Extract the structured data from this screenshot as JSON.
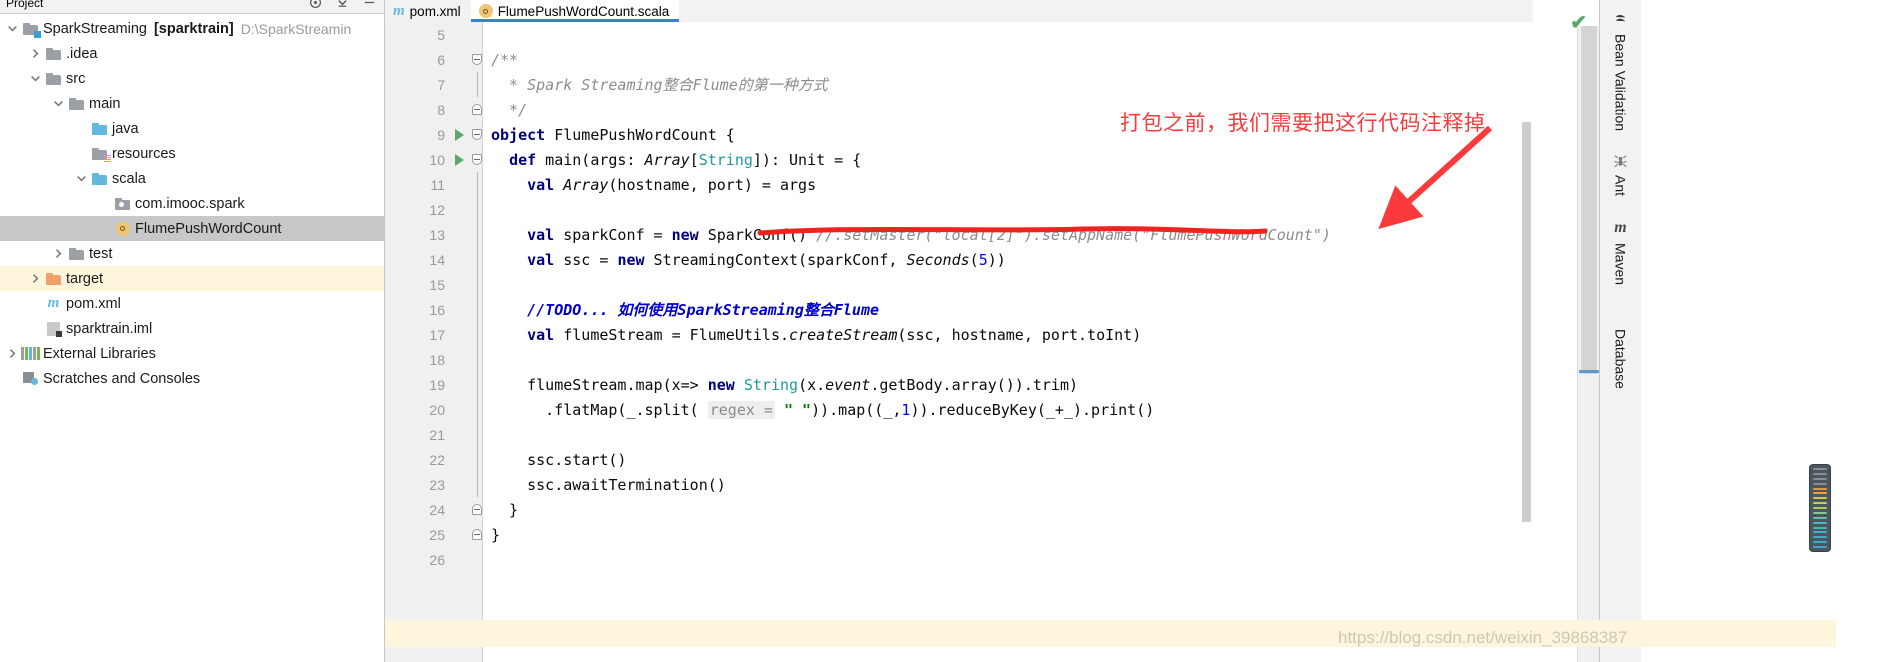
{
  "window": {
    "ide": "IntelliJ IDEA",
    "watermark": "https://blog.csdn.net/weixin_39868387"
  },
  "project_panel": {
    "title": "Project",
    "toolbar_icons": [
      "target-icon",
      "collapse-icon",
      "settings-icon"
    ],
    "tree": [
      {
        "label": "SparkStreaming",
        "bracket": "[sparktrain]",
        "path": "D:\\SparkStreamin",
        "icon": "module-folder-icon",
        "indent": 0,
        "arrow": "expanded",
        "state": "normal"
      },
      {
        "label": ".idea",
        "icon": "folder-gray-icon",
        "indent": 1,
        "arrow": "collapsed",
        "state": "normal"
      },
      {
        "label": "src",
        "icon": "folder-gray-icon",
        "indent": 1,
        "arrow": "expanded",
        "state": "normal"
      },
      {
        "label": "main",
        "icon": "folder-gray-icon",
        "indent": 2,
        "arrow": "expanded",
        "state": "normal"
      },
      {
        "label": "java",
        "icon": "folder-source-blue-icon",
        "indent": 3,
        "arrow": "none",
        "state": "normal"
      },
      {
        "label": "resources",
        "icon": "folder-resources-icon",
        "indent": 3,
        "arrow": "none",
        "state": "normal"
      },
      {
        "label": "scala",
        "icon": "folder-source-blue-icon",
        "indent": 3,
        "arrow": "expanded",
        "state": "normal"
      },
      {
        "label": "com.imooc.spark",
        "icon": "package-icon",
        "indent": 4,
        "arrow": "none",
        "state": "normal"
      },
      {
        "label": "FlumePushWordCount",
        "icon": "scala-object-icon",
        "indent": 4,
        "arrow": "none",
        "state": "selected"
      },
      {
        "label": "test",
        "icon": "folder-gray-icon",
        "indent": 2,
        "arrow": "collapsed",
        "state": "normal"
      },
      {
        "label": "target",
        "icon": "folder-orange-icon",
        "indent": 1,
        "arrow": "collapsed",
        "state": "highlight"
      },
      {
        "label": "pom.xml",
        "icon": "maven-m-icon",
        "indent": 1,
        "arrow": "none",
        "state": "normal"
      },
      {
        "label": "sparktrain.iml",
        "icon": "iml-file-icon",
        "indent": 1,
        "arrow": "none",
        "state": "normal"
      },
      {
        "label": "External Libraries",
        "icon": "external-libraries-icon",
        "indent": 0,
        "arrow": "collapsed",
        "state": "normal"
      },
      {
        "label": "Scratches and Consoles",
        "icon": "scratches-icon",
        "indent": 0,
        "arrow": "none",
        "state": "normal"
      }
    ]
  },
  "editor": {
    "tabs": [
      {
        "label": "pom.xml",
        "icon": "maven-m-icon",
        "active": false
      },
      {
        "label": "FlumePushWordCount.scala",
        "icon": "scala-object-icon",
        "active": true
      }
    ],
    "lines": [
      {
        "n": "5",
        "text": "",
        "type": "blank"
      },
      {
        "n": "6",
        "text": "/**",
        "type": "comment",
        "fold": "top"
      },
      {
        "n": "7",
        "text": "  * Spark Streaming整合Flume的第一种方式",
        "type": "comment"
      },
      {
        "n": "8",
        "text": "  */",
        "type": "comment",
        "fold": "bottom"
      },
      {
        "n": "9",
        "text": "object FlumePushWordCount {",
        "type": "code",
        "run": true,
        "fold": "top"
      },
      {
        "n": "10",
        "text": "  def main(args: Array[String]): Unit = {",
        "type": "code",
        "run": true,
        "fold": "top"
      },
      {
        "n": "11",
        "text": "    val Array(hostname, port) = args",
        "type": "code"
      },
      {
        "n": "12",
        "text": "",
        "type": "blank"
      },
      {
        "n": "13",
        "text": "    val sparkConf = new SparkConf() //.setMaster(\"local[2]\").setAppName(\"FlumePushWordCount\")",
        "type": "code"
      },
      {
        "n": "14",
        "text": "    val ssc = new StreamingContext(sparkConf, Seconds(5))",
        "type": "code"
      },
      {
        "n": "15",
        "text": "",
        "type": "blank"
      },
      {
        "n": "16",
        "text": "    //TODO... 如何使用SparkStreaming整合Flume",
        "type": "todo"
      },
      {
        "n": "17",
        "text": "    val flumeStream = FlumeUtils.createStream(ssc, hostname, port.toInt)",
        "type": "code"
      },
      {
        "n": "18",
        "text": "",
        "type": "blank"
      },
      {
        "n": "19",
        "text": "    flumeStream.map(x=> new String(x.event.getBody.array()).trim)",
        "type": "code"
      },
      {
        "n": "20",
        "text": "      .flatMap(_.split( regex = \" \")).map((_,1)).reduceByKey(_+_).print()",
        "type": "code",
        "hint": "regex ="
      },
      {
        "n": "21",
        "text": "",
        "type": "blank"
      },
      {
        "n": "22",
        "text": "    ssc.start()",
        "type": "code"
      },
      {
        "n": "23",
        "text": "    ssc.awaitTermination()",
        "type": "code"
      },
      {
        "n": "24",
        "text": "  }",
        "type": "code",
        "fold": "bottom"
      },
      {
        "n": "25",
        "text": "}",
        "type": "code",
        "fold": "bottom"
      },
      {
        "n": "26",
        "text": "",
        "type": "blank"
      }
    ]
  },
  "annotation": {
    "text": "打包之前，我们需要把这行代码注释掉",
    "color": "#fb3b3b",
    "arrow": "down-left-arrow",
    "underline": "red-wavy-underline"
  },
  "right_bar": {
    "items": [
      {
        "label": "Bean Validation",
        "icon": "bean-validation-icon"
      },
      {
        "label": "Ant",
        "icon": "ant-icon"
      },
      {
        "label": "Maven",
        "icon": "maven-m-icon"
      },
      {
        "label": "Database",
        "icon": "database-icon"
      }
    ]
  },
  "status": {
    "inspection": "ok-check-icon"
  }
}
